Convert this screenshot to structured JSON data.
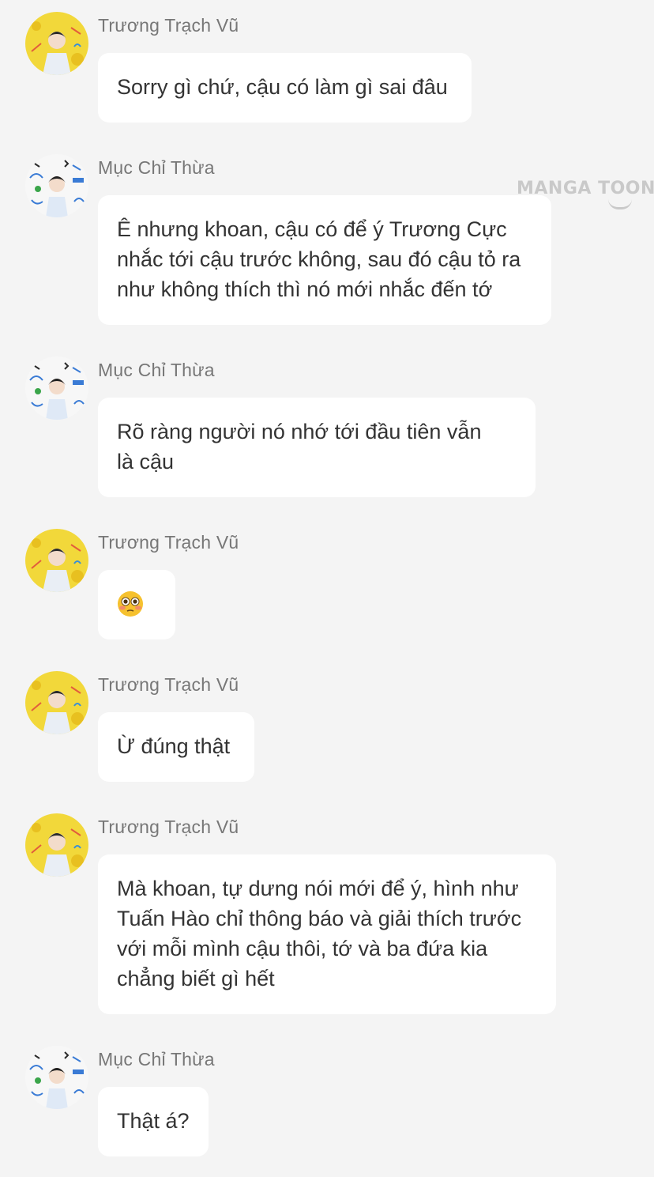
{
  "watermark": "MANGA TOON",
  "messages": [
    {
      "sender": "Trương Trạch Vũ",
      "avatar": "avatar-yellow",
      "lines": [
        "Sorry gì chứ, cậu có làm gì sai đâu"
      ]
    },
    {
      "sender": "Mục Chỉ Thừa",
      "avatar": "avatar-sketch",
      "lines": [
        "Ê nhưng khoan, cậu có để ý Trương Cực",
        "nhắc tới cậu trước không, sau đó cậu tỏ ra",
        "như không thích thì nó mới nhắc đến tớ"
      ]
    },
    {
      "sender": "Mục Chỉ Thừa",
      "avatar": "avatar-sketch",
      "lines": [
        "Rõ ràng người nó nhớ tới đầu tiên vẫn",
        "là cậu"
      ]
    },
    {
      "sender": "Trương Trạch Vũ",
      "avatar": "avatar-yellow",
      "emoji": "flushed-face-emoji"
    },
    {
      "sender": "Trương Trạch Vũ",
      "avatar": "avatar-yellow",
      "lines": [
        "Ừ đúng thật"
      ]
    },
    {
      "sender": "Trương Trạch Vũ",
      "avatar": "avatar-yellow",
      "lines": [
        "Mà khoan, tự dưng nói mới để ý, hình như",
        "Tuấn Hào chỉ thông báo và giải thích trước",
        "với mỗi mình cậu thôi, tớ và ba đứa kia",
        "chẳng biết gì hết"
      ]
    },
    {
      "sender": "Mục Chỉ Thừa",
      "avatar": "avatar-sketch",
      "lines": [
        "Thật á?"
      ]
    }
  ]
}
